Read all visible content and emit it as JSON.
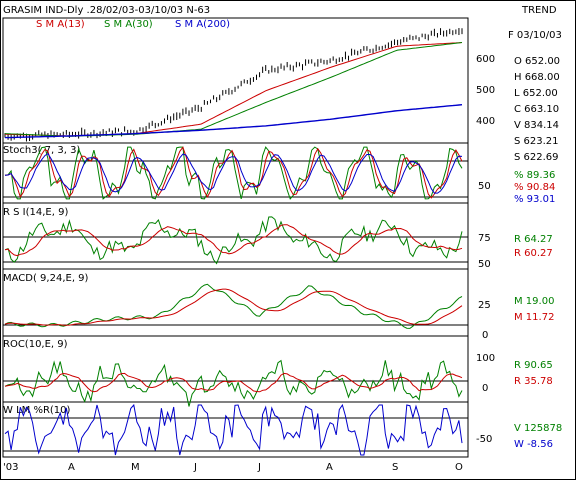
{
  "header": {
    "title": "GRASIM IND-Dly .28/02/03-03/10/03  N-63",
    "trend": "TREND"
  },
  "colors": {
    "price": "#000000",
    "sma13": "#cc0000",
    "sma30": "#008000",
    "sma200": "#0000cc",
    "green": "#008000",
    "red": "#cc0000",
    "blue": "#0000cc",
    "olive": "#808000"
  },
  "legend": {
    "sma13": "S M A(13)",
    "sma30": "S M A(30)",
    "sma200": "S M A(200)"
  },
  "price_info": [
    {
      "text": "F 03/10/03",
      "color": "#000000"
    },
    {
      "text": "O  652.00",
      "color": "#000000"
    },
    {
      "text": "H  668.00",
      "color": "#808000"
    },
    {
      "text": "L  652.00",
      "color": "#808000"
    },
    {
      "text": "C  663.10",
      "color": "#808000"
    },
    {
      "text": "V  834.14",
      "color": "#000000"
    },
    {
      "text": "S  623.21",
      "color": "#cc0000"
    },
    {
      "text": "S  622.69",
      "color": "#008000"
    }
  ],
  "x_labels": [
    "'03",
    "A",
    "M",
    "J",
    "J",
    "A",
    "S",
    "O"
  ],
  "panels": [
    {
      "key": "price",
      "title": "",
      "ticks": [
        "600",
        "500",
        "400"
      ]
    },
    {
      "key": "stoch",
      "title": "Stoch3( 7, 3, 3)",
      "ticks": [
        "50"
      ],
      "values": [
        {
          "text": "%  89.36",
          "color": "#008000"
        },
        {
          "text": "%  90.84",
          "color": "#cc0000"
        },
        {
          "text": "%  93.01",
          "color": "#0000cc"
        }
      ]
    },
    {
      "key": "rsi",
      "title": "R S I(14,E, 9)",
      "ticks": [
        "75",
        "50"
      ],
      "values": [
        {
          "text": "R   64.27",
          "color": "#008000"
        },
        {
          "text": "R   60.27",
          "color": "#cc0000"
        }
      ]
    },
    {
      "key": "macd",
      "title": "MACD( 9,24,E, 9)",
      "ticks": [
        "25",
        "0"
      ],
      "values": [
        {
          "text": "M   19.00",
          "color": "#008000"
        },
        {
          "text": "M   11.72",
          "color": "#cc0000"
        }
      ]
    },
    {
      "key": "roc",
      "title": "ROC(10,E, 9)",
      "ticks": [
        "100",
        "0"
      ],
      "values": [
        {
          "text": "R   90.65",
          "color": "#008000"
        },
        {
          "text": "R   35.78",
          "color": "#cc0000"
        }
      ]
    },
    {
      "key": "wlm",
      "title": "W LM %R(10)",
      "ticks": [
        "-50"
      ],
      "values": [
        {
          "text": "V  125878",
          "color": "#008000"
        },
        {
          "text": "W    -8.56",
          "color": "#0000cc"
        }
      ]
    }
  ],
  "chart_data": {
    "type": "line",
    "title": "GRASIM IND-Dly .28/02/03-03/10/03  N-63",
    "x": [
      "'03",
      "A",
      "M",
      "J",
      "J",
      "A",
      "S",
      "O"
    ],
    "series": [
      {
        "name": "S M A(13)",
        "values": [
          350,
          345,
          352,
          380,
          480,
          550,
          612,
          623
        ]
      },
      {
        "name": "S M A(30)",
        "values": [
          352,
          344,
          350,
          365,
          445,
          520,
          600,
          623
        ]
      },
      {
        "name": "S M A(200)",
        "values": [
          340,
          345,
          352,
          362,
          375,
          395,
          420,
          438
        ]
      },
      {
        "name": "Close",
        "values": [
          345,
          350,
          360,
          430,
          540,
          570,
          625,
          663
        ]
      }
    ],
    "ylim": [
      330,
      690
    ]
  }
}
